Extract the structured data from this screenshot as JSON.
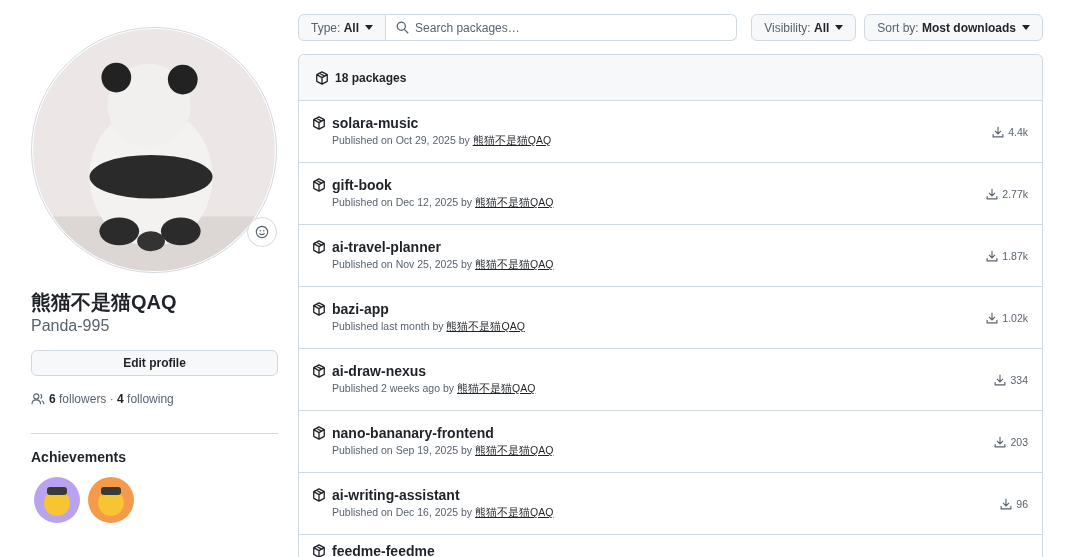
{
  "profile": {
    "display_name": "熊猫不是猫QAQ",
    "username": "Panda-995",
    "edit_button": "Edit profile",
    "social": "**6** followers · **4** following"
  },
  "achievements": {
    "title": "Achievements",
    "badges": [
      {
        "color": "#b9a3f0"
      },
      {
        "color": "#f59a4a"
      }
    ]
  },
  "toolbar": {
    "type_filter": "Type: **All**",
    "search": {
      "placeholder": "Search packages…"
    },
    "visibility_filter": "Visibility: **All**",
    "sort": "Sort by: **Most downloads**"
  },
  "packages": {
    "count": "18 packages",
    "items": [
      {
        "name": "solara-music",
        "published": "Published on Oct 29, 2025 by",
        "author": "熊猫不是猫QAQ",
        "downloads": "4.4k"
      },
      {
        "name": "gift-book",
        "published": "Published on Dec 12, 2025 by",
        "author": "熊猫不是猫QAQ",
        "downloads": "2.77k"
      },
      {
        "name": "ai-travel-planner",
        "published": "Published on Nov 25, 2025 by",
        "author": "熊猫不是猫QAQ",
        "downloads": "1.87k"
      },
      {
        "name": "bazi-app",
        "published": "Published last month by",
        "author": "熊猫不是猫QAQ",
        "downloads": "1.02k"
      },
      {
        "name": "ai-draw-nexus",
        "published": "Published 2 weeks ago by",
        "author": "熊猫不是猫QAQ",
        "downloads": "334"
      },
      {
        "name": "nano-bananary-frontend",
        "published": "Published on Sep 19, 2025 by",
        "author": "熊猫不是猫QAQ",
        "downloads": "203"
      },
      {
        "name": "ai-writing-assistant",
        "published": "Published on Dec 16, 2025 by",
        "author": "熊猫不是猫QAQ",
        "downloads": "96"
      },
      {
        "name": "feedme-feedme"
      }
    ]
  }
}
